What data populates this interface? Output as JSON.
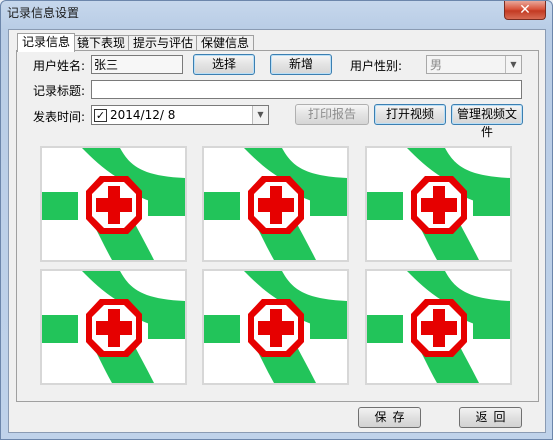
{
  "window": {
    "title": "记录信息设置",
    "close_label": "✕"
  },
  "tabs": [
    {
      "label": "记录信息",
      "active": true
    },
    {
      "label": "镜下表现",
      "active": false
    },
    {
      "label": "提示与评估",
      "active": false
    },
    {
      "label": "保健信息",
      "active": false
    }
  ],
  "form": {
    "user_name_label": "用户姓名:",
    "user_name_value": "张三",
    "select_button": "选择",
    "new_button": "新增",
    "gender_label": "用户性别:",
    "gender_value": "男",
    "record_title_label": "记录标题:",
    "record_title_value": "",
    "publish_time_label": "发表时间:",
    "publish_time_value": "2014/12/ 8",
    "publish_time_checked": true,
    "print_report_button": "打印报告",
    "open_video_button": "打开视频",
    "manage_video_button": "管理视频文件"
  },
  "images": [
    {
      "icon": "medical-cross-image"
    },
    {
      "icon": "medical-cross-image"
    },
    {
      "icon": "medical-cross-image"
    },
    {
      "icon": "medical-cross-image"
    },
    {
      "icon": "medical-cross-image"
    },
    {
      "icon": "medical-cross-image"
    }
  ],
  "footer": {
    "save_button": "保存",
    "back_button": "返回"
  },
  "colors": {
    "green": "#22c45a",
    "red": "#e60000",
    "titlebar": "#c6d7ec"
  }
}
